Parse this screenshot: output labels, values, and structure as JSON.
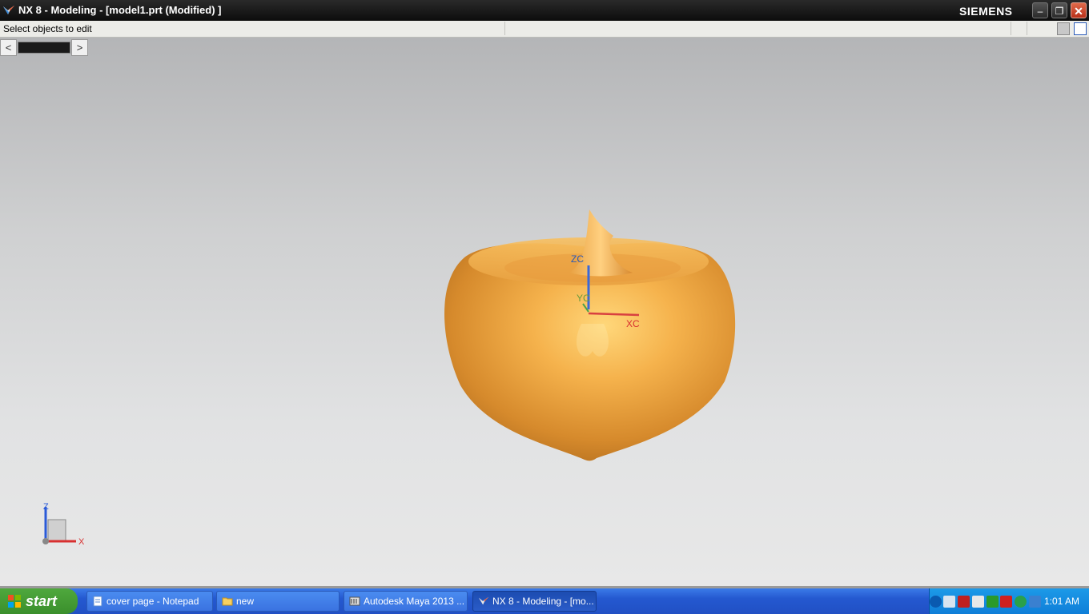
{
  "window": {
    "title": "NX 8 - Modeling - [model1.prt (Modified) ]",
    "brand": "SIEMENS",
    "minimize": "–",
    "restore": "❐",
    "close": "✕"
  },
  "cue_line": {
    "text": "Select objects to edit"
  },
  "resource_bar": {
    "prev": "<",
    "next": ">"
  },
  "viewport": {
    "model_color": "#f0a53c",
    "wcs_labels": {
      "z": "ZC",
      "y": "YC",
      "x": "XC"
    },
    "triad_labels": {
      "z": "Z",
      "x": "X"
    }
  },
  "taskbar": {
    "start_label": "start",
    "items": [
      {
        "label": "cover page - Notepad",
        "icon": "notepad-icon"
      },
      {
        "label": "new",
        "icon": "folder-icon"
      },
      {
        "label": "Autodesk Maya 2013 ...",
        "icon": "maya-icon"
      },
      {
        "label": "NX 8 - Modeling - [mo...",
        "icon": "nx-icon"
      }
    ],
    "clock": "1:01 AM"
  }
}
